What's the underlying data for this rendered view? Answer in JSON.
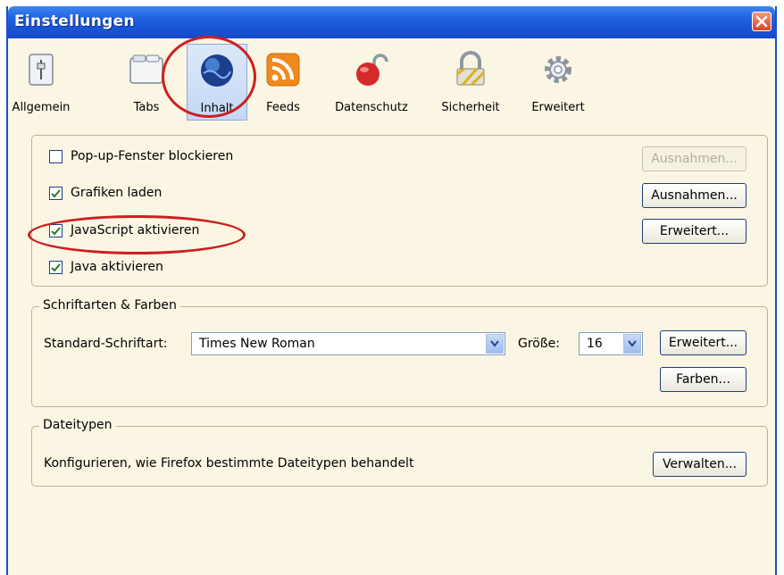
{
  "window": {
    "title": "Einstellungen"
  },
  "toolbar": {
    "items": [
      {
        "label": "Allgemein",
        "icon": "general-switch-icon"
      },
      {
        "label": "Tabs",
        "icon": "tabs-window-icon"
      },
      {
        "label": "Inhalt",
        "icon": "globe-icon",
        "selected": true
      },
      {
        "label": "Feeds",
        "icon": "rss-feed-icon"
      },
      {
        "label": "Datenschutz",
        "icon": "privacy-lock-icon"
      },
      {
        "label": "Sicherheit",
        "icon": "security-padlock-icon"
      },
      {
        "label": "Erweitert",
        "icon": "gear-icon"
      }
    ]
  },
  "content": {
    "popup_label": "Pop-up-Fenster blockieren",
    "popup_checked": false,
    "images_label": "Grafiken laden",
    "images_checked": true,
    "javascript_label": "JavaScript aktivieren",
    "javascript_checked": true,
    "java_label": "Java aktivieren",
    "java_checked": true,
    "popup_exceptions_button": "Ausnahmen...",
    "images_exceptions_button": "Ausnahmen...",
    "javascript_advanced_button": "Erweitert..."
  },
  "fonts": {
    "legend": "Schriftarten & Farben",
    "default_font_label": "Standard-Schriftart:",
    "default_font_value": "Times New Roman",
    "size_label": "Größe:",
    "size_value": "16",
    "advanced_button": "Erweitert...",
    "colors_button": "Farben..."
  },
  "filetypes": {
    "legend": "Dateitypen",
    "description": "Konfigurieren, wie Firefox bestimmte Dateitypen behandelt",
    "manage_button": "Verwalten..."
  },
  "colors": {
    "title_bar": "#1f5fe0",
    "dialog_bg": "#fbf6e3",
    "highlight": "#cc1f1f"
  }
}
